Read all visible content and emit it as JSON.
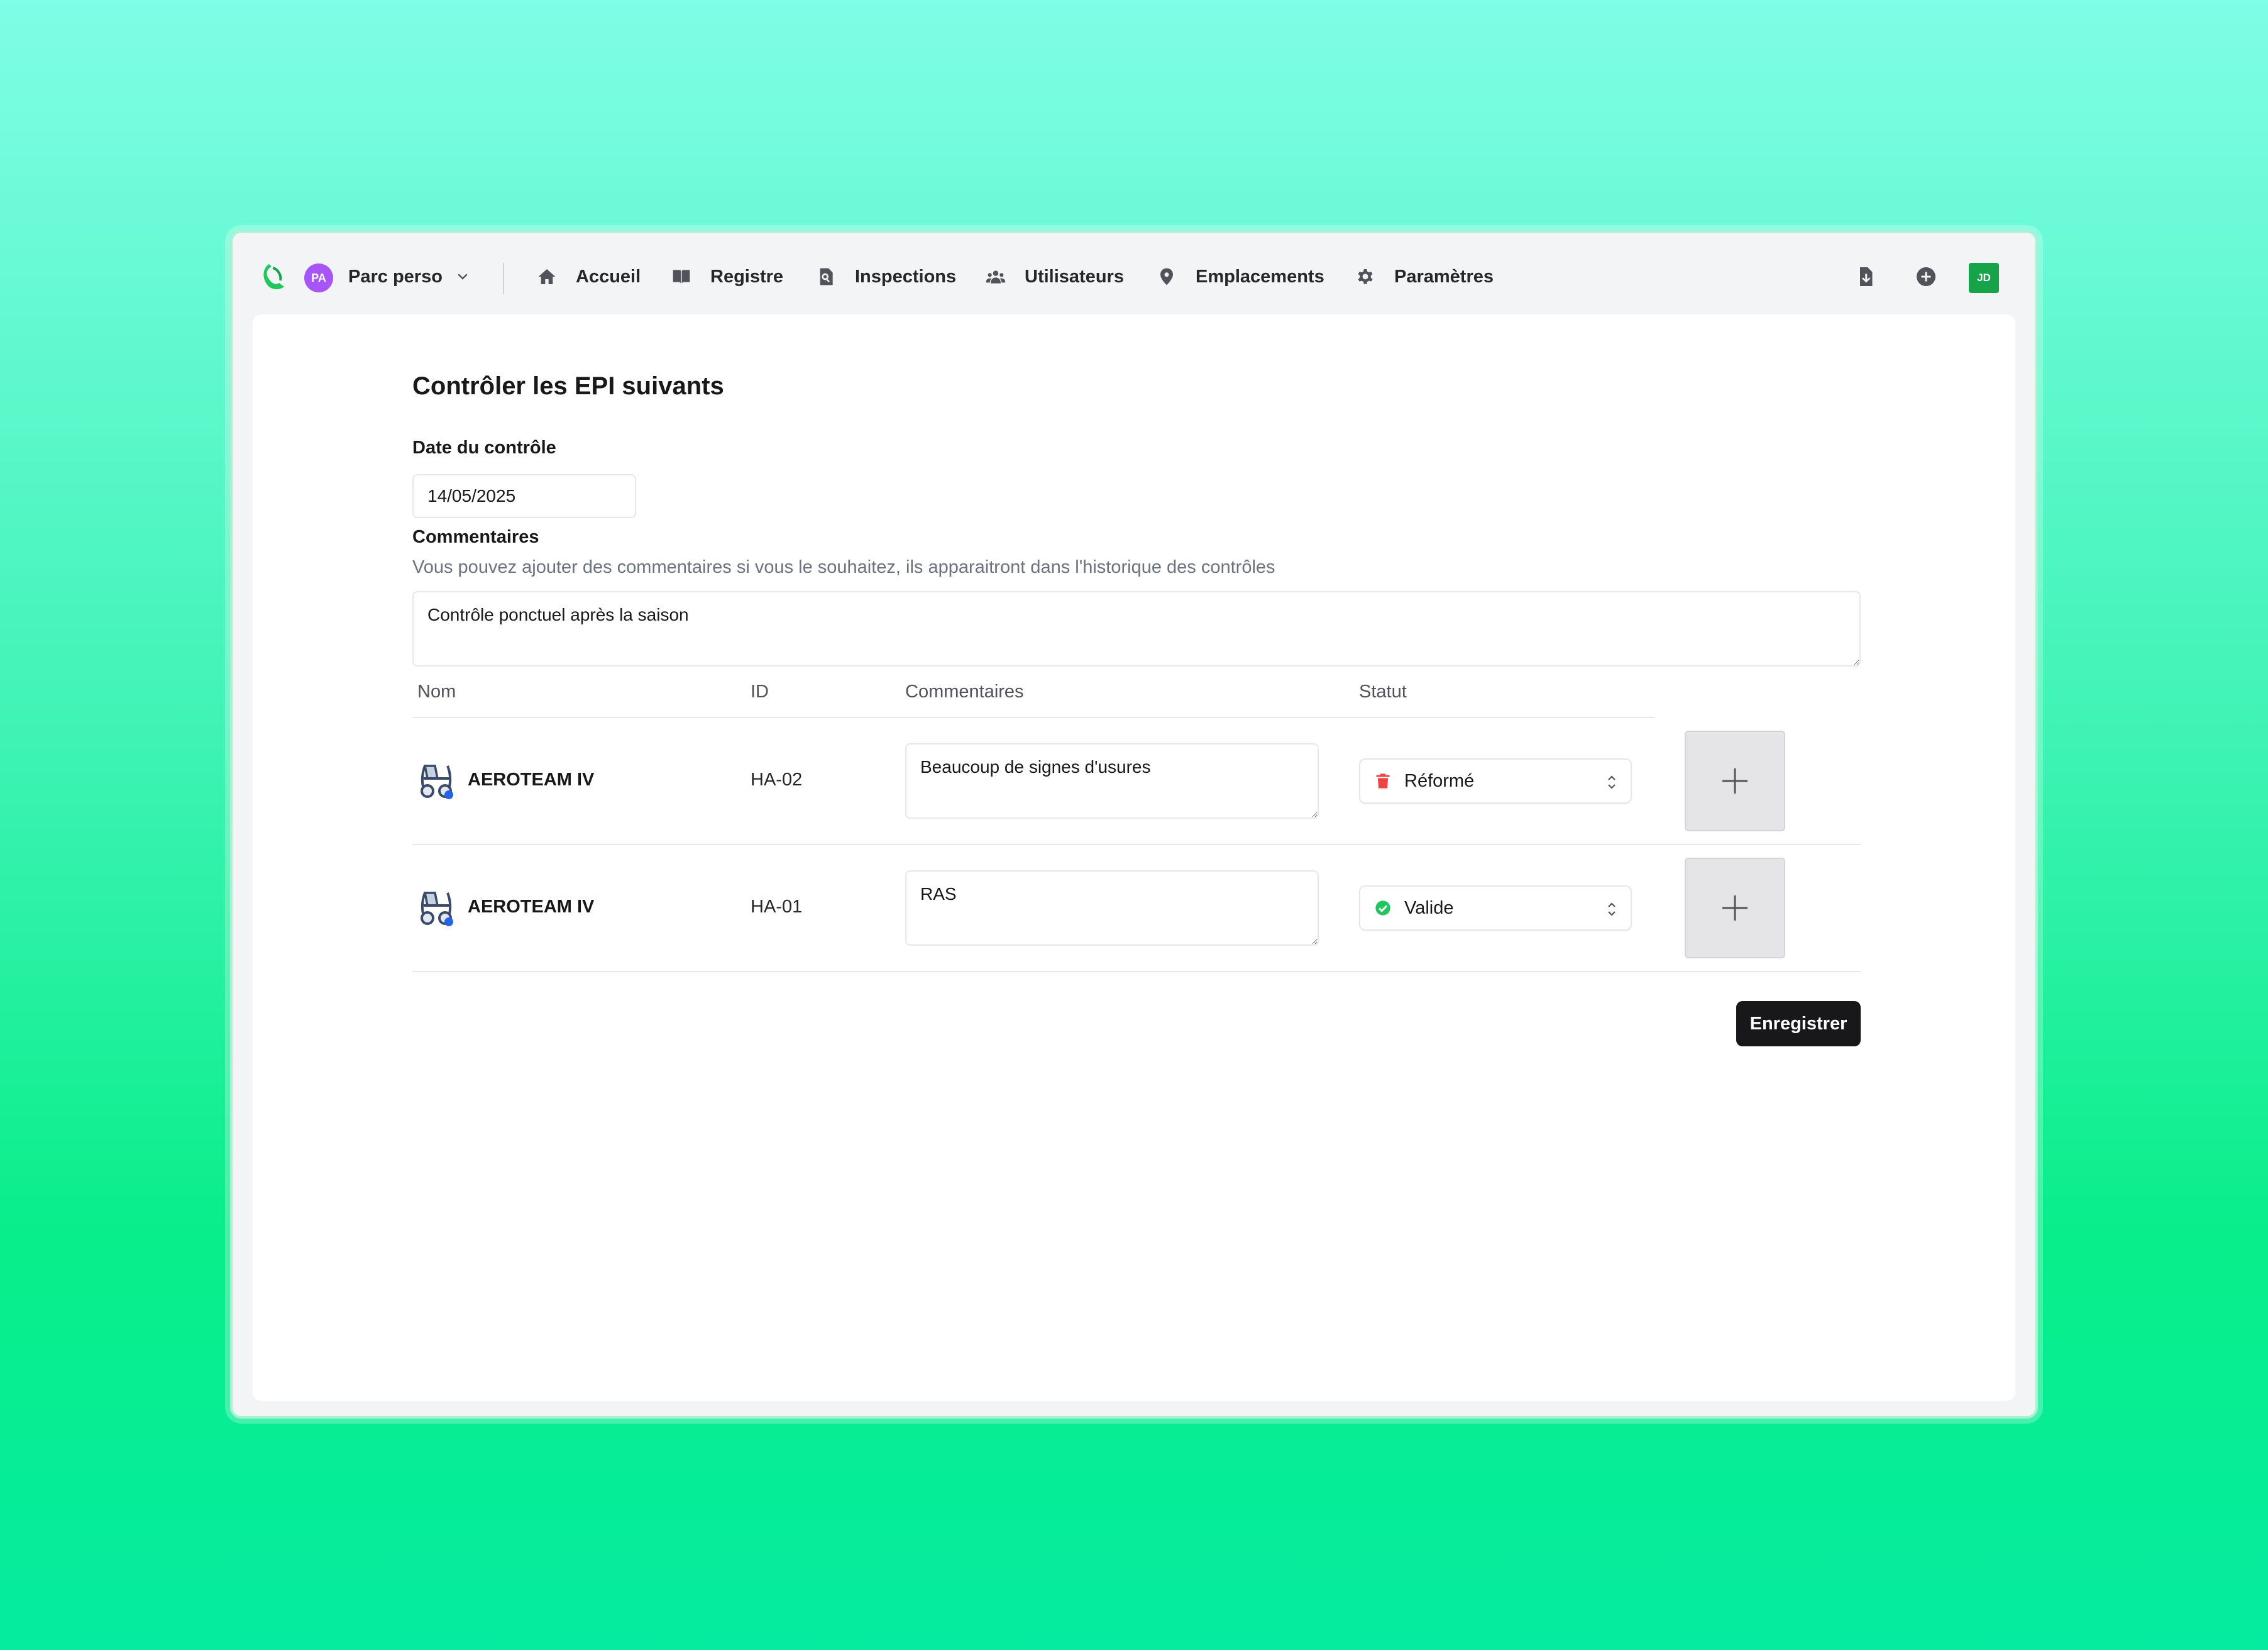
{
  "nav": {
    "org_initials": "PA",
    "org_name": "Parc perso",
    "items": [
      {
        "label": "Accueil",
        "icon": "home-icon"
      },
      {
        "label": "Registre",
        "icon": "book-icon"
      },
      {
        "label": "Inspections",
        "icon": "search-document-icon"
      },
      {
        "label": "Utilisateurs",
        "icon": "users-icon"
      },
      {
        "label": "Emplacements",
        "icon": "map-pin-icon"
      },
      {
        "label": "Paramètres",
        "icon": "gear-icon"
      }
    ],
    "right_icons": [
      "document-download-icon",
      "plus-circle-icon"
    ],
    "user_initials": "JD"
  },
  "form": {
    "title": "Contrôler les EPI suivants",
    "date_label": "Date du contrôle",
    "date_value": "14/05/2025",
    "comments_label": "Commentaires",
    "comments_help": "Vous pouvez ajouter des commentaires si vous le souhaitez, ils apparaitront dans l'historique des contrôles",
    "comments_value": "Contrôle ponctuel après la saison",
    "save_label": "Enregistrer"
  },
  "table": {
    "headers": [
      "Nom",
      "ID",
      "Commentaires",
      "Statut"
    ],
    "rows": [
      {
        "name": "AEROTEAM IV",
        "id": "HA-02",
        "comment": "Beaucoup de signes d'usures",
        "status": "Réformé",
        "status_icon": "trash-icon",
        "status_color": "#ef4444"
      },
      {
        "name": "AEROTEAM IV",
        "id": "HA-01",
        "comment": "RAS",
        "status": "Valide",
        "status_icon": "check-circle-icon",
        "status_color": "#22c55e"
      }
    ]
  },
  "colors": {
    "accent": "#18181b",
    "org_avatar": "#a855f7",
    "user_avatar": "#16a34a"
  }
}
